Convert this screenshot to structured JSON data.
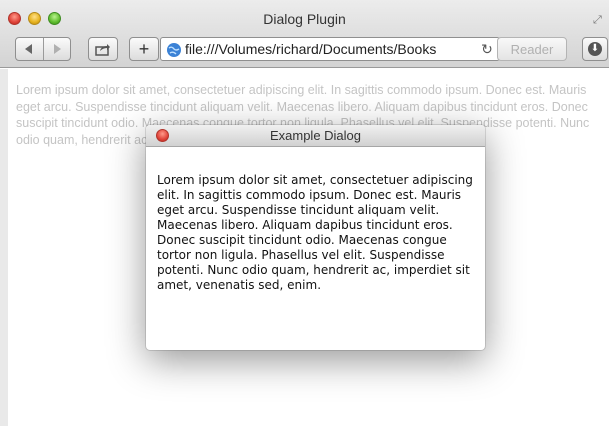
{
  "window": {
    "title": "Dialog Plugin",
    "traffic_lights": [
      "close",
      "minimize",
      "zoom"
    ]
  },
  "toolbar": {
    "back_icon": "back-arrow",
    "forward_icon": "forward-arrow",
    "share_icon": "share-icon",
    "new_tab_label": "+",
    "address": "file:///Volumes/richard/Documents/Books",
    "reload_icon": "reload-icon",
    "reader_label": "Reader",
    "download_icon": "download-icon"
  },
  "page": {
    "paragraph": "Lorem ipsum dolor sit amet, consectetuer adipiscing elit. In sagittis commodo ipsum. Donec est. Mauris eget arcu. Suspendisse tincidunt aliquam velit. Maecenas libero. Aliquam dapibus tincidunt eros. Donec suscipit tincidunt odio. Maecenas congue tortor non ligula. Phasellus vel elit. Suspendisse potenti. Nunc odio quam, hendrerit ac, imperdiet sit amet, venenatis sed, enim."
  },
  "dialog": {
    "title": "Example Dialog",
    "body": "Lorem ipsum dolor sit amet, consectetuer adipiscing elit. In sagittis commodo ipsum. Donec est. Mauris eget arcu. Suspendisse tincidunt aliquam velit. Maecenas libero. Aliquam dapibus tincidunt eros. Donec suscipit tincidunt odio. Maecenas congue tortor non ligula. Phasellus vel elit. Suspendisse potenti. Nunc odio quam, hendrerit ac, imperdiet sit amet, venenatis sed, enim."
  },
  "colors": {
    "page_text": "#c4c4c4",
    "dialog_text": "#111111",
    "close_button": "#e0443a"
  }
}
